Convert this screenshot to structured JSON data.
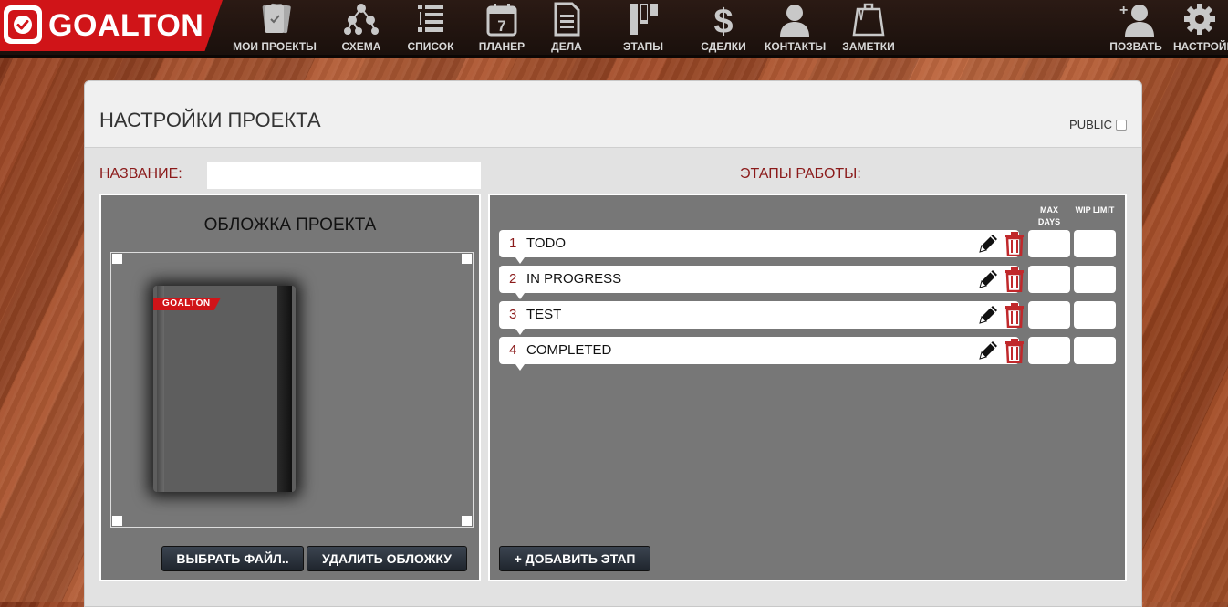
{
  "brand": {
    "name": "GOALTON",
    "logo_icon": "check-badge-icon",
    "accent": "#d01418"
  },
  "nav": [
    {
      "label": "МОИ ПРОЕКТЫ",
      "icon": "projects-icon"
    },
    {
      "label": "СХЕМА",
      "icon": "scheme-icon"
    },
    {
      "label": "СПИСОК",
      "icon": "list-icon"
    },
    {
      "label": "ПЛАНЕР",
      "icon": "calendar-icon"
    },
    {
      "label": "ДЕЛА",
      "icon": "document-icon"
    },
    {
      "label": "ЭТАПЫ",
      "icon": "stages-icon"
    },
    {
      "label": "СДЕЛКИ",
      "icon": "dollar-icon"
    },
    {
      "label": "КОНТАКТЫ",
      "icon": "contact-icon"
    },
    {
      "label": "ЗАМЕТКИ",
      "icon": "notes-icon"
    },
    {
      "label": "ПОЗВАТЬ",
      "icon": "invite-user-icon"
    },
    {
      "label": "НАСТРОЙКИ",
      "icon": "settings-icon"
    }
  ],
  "page": {
    "title": "НАСТРОЙКИ ПРОЕКТА",
    "public_label": "PUBLIC",
    "public_checked": false,
    "name_label": "НАЗВАНИЕ:",
    "name_value": "",
    "stages_label": "ЭТАПЫ РАБОТЫ:"
  },
  "cover": {
    "title": "ОБЛОЖКА ПРОЕКТА",
    "book_brand": "GOALTON",
    "choose_button": "ВЫБРАТЬ ФАЙЛ..",
    "delete_button": "УДАЛИТЬ ОБЛОЖКУ"
  },
  "stages": {
    "max_days_header": "MAX DAYS",
    "wip_limit_header": "WIP LIMIT",
    "add_button": "+ ДОБАВИТЬ ЭТАП",
    "items": [
      {
        "num": "1",
        "name": "TODO",
        "max_days": "",
        "wip_limit": ""
      },
      {
        "num": "2",
        "name": "IN PROGRESS",
        "max_days": "",
        "wip_limit": ""
      },
      {
        "num": "3",
        "name": "TEST",
        "max_days": "",
        "wip_limit": ""
      },
      {
        "num": "4",
        "name": "COMPLETED",
        "max_days": "",
        "wip_limit": ""
      }
    ]
  }
}
